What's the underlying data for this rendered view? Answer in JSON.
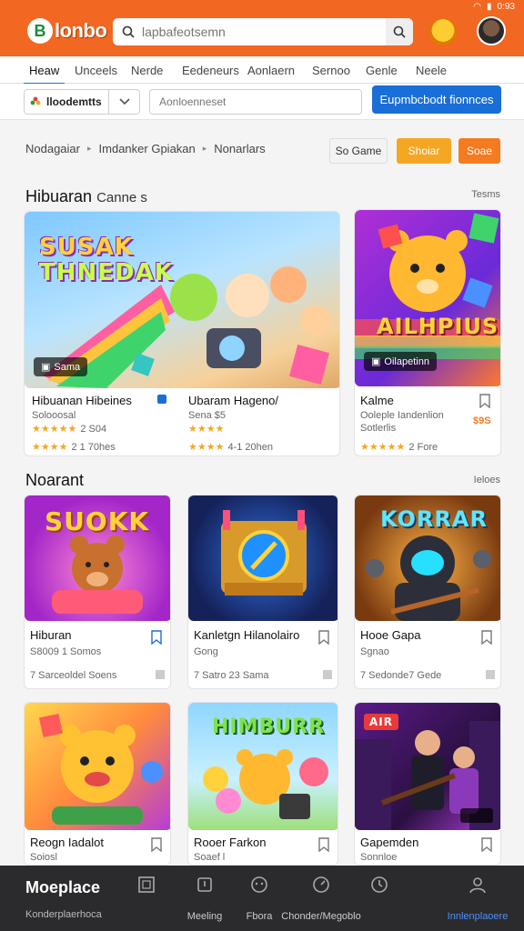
{
  "status": {
    "time": "0:93"
  },
  "header": {
    "logo_letter": "B",
    "logo_text": "lonbo",
    "search_placeholder": "lapbafeotsemn"
  },
  "nav": {
    "tabs": [
      "Heaw",
      "Unceels",
      "Nerde",
      "Eedeneurs",
      "Aonlaern",
      "Sernoo",
      "Genle",
      "Neele"
    ]
  },
  "filters": {
    "select_label": "lloodemtts",
    "input_placeholder": "Aonloenneset",
    "primary_button": "Eupmbcbodt fionnces"
  },
  "breadcrumbs": [
    "Nodagaiar",
    "Imdanker Gpiakan",
    "Nonarlars"
  ],
  "chips": [
    "So Game",
    "Shoiar",
    "Soae"
  ],
  "section1": {
    "title": "Hibuaran",
    "title_suffix": "Canne s",
    "link": "Tesms",
    "cards": [
      {
        "thumb_title_line1": "SUSAK",
        "thumb_title_line2": "THNEDAK",
        "badge": "Sama",
        "title_a": "Hibuanan Hibeines",
        "sub_a": "Solooosal",
        "stars_a": "★★★★★",
        "rating_a": "2 S04",
        "stars_a2": "★★★★",
        "rating_a2": "2 1 70hes",
        "title_b": "Ubaram Hageno/",
        "sub_b": "Sena $5",
        "stars_b": "★★★★",
        "stars_b2": "★★★★",
        "rating_b2": "4-1 20hen"
      },
      {
        "thumb_title": "AILHPIUS",
        "badge": "Oilapetinn",
        "title": "Kalme",
        "sub": "Ooleple Iandenlion",
        "sub2": "Sotlerlis",
        "price": "$9S",
        "stars": "★★★★★",
        "rating": "2 Fore"
      }
    ]
  },
  "section2": {
    "title": "Noarant",
    "link": "Ieloes",
    "cards": [
      {
        "thumb_title": "SUOKK",
        "title": "Hiburan",
        "sub": "S8009 1 Somos",
        "meta": "7 Sarceoldel Soens"
      },
      {
        "thumb_title": "",
        "title": "Kanletgn Hilanolairo",
        "sub": "Gong",
        "meta": "7 Satro 23 Sama"
      },
      {
        "thumb_title": "KORRAR",
        "title": "Hooe Gapa",
        "sub": "Sgnao",
        "meta": "7 Sedonde7 Gede"
      },
      {
        "thumb_title": "",
        "title": "Reogn Iadalot",
        "sub": "Soiosl",
        "meta": ""
      },
      {
        "thumb_title": "HIMBURR",
        "title": "Rooer Farkon",
        "sub": "Soaef l",
        "meta": ""
      },
      {
        "thumb_title": "AIR",
        "title": "Gapemden",
        "sub": "Sonnloe",
        "meta": ""
      }
    ]
  },
  "bottom": {
    "brand": "Moeplace",
    "brand_sub": "Konderplaerhoca",
    "items": [
      "",
      "Meeling",
      "Fbora",
      "Chonder/Megoblo",
      "",
      "Innlenplaoere"
    ]
  },
  "colors": {
    "accent": "#f26722",
    "primary": "#1a6ed8",
    "star": "#f5a623"
  }
}
